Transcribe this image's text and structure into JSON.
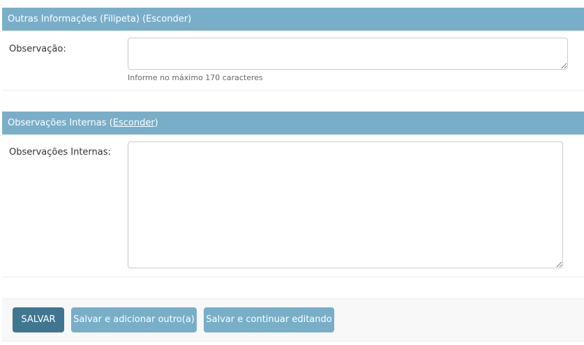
{
  "other_info_section": {
    "title": "Outras Informações (Filipeta)",
    "toggle_label": "(Esconder)",
    "observation_label": "Observação:",
    "observation_value": "",
    "observation_help": "Informe no máximo 170 caracteres"
  },
  "internal_notes_section": {
    "title": "Observações Internas",
    "toggle_open": "(",
    "toggle_label": "Esconder",
    "toggle_close": ")",
    "notes_label": "Observações Internas:",
    "notes_value": ""
  },
  "submit_row": {
    "save_label": "SALVAR",
    "save_add_another_label": "Salvar e adicionar outro(a)",
    "save_continue_label": "Salvar e continuar editando"
  },
  "colors": {
    "header_background": "#79aec8",
    "primary_button": "#417690",
    "secondary_button": "#79aec8"
  }
}
